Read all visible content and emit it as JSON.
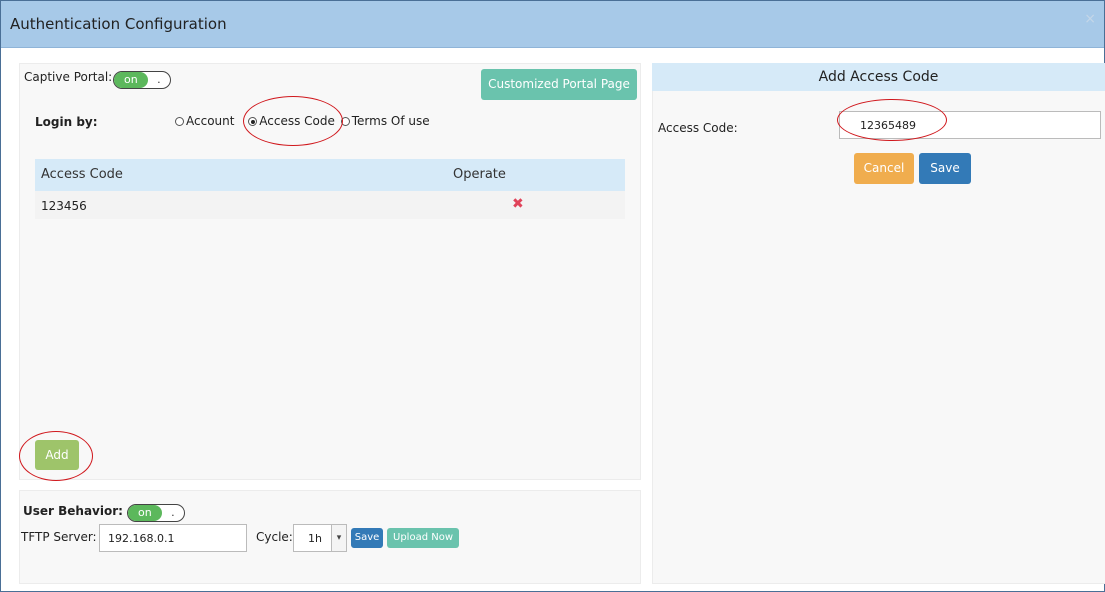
{
  "dialog": {
    "title": "Authentication Configuration",
    "close_glyph": "×"
  },
  "captive": {
    "label": "Captive Portal:",
    "toggle_on": "on",
    "toggle_knob": ".",
    "customized_button": "Customized Portal Page",
    "login_label": "Login by:",
    "options": [
      "Account",
      "Access Code",
      "Terms Of use"
    ],
    "selected_option": "Access Code",
    "table": {
      "headers": [
        "Access Code",
        "Operate"
      ],
      "rows": [
        {
          "code": "123456",
          "operate_glyph": "✖"
        }
      ]
    },
    "add_button": "Add"
  },
  "user_behavior": {
    "label": "User Behavior:",
    "toggle_on": "on",
    "toggle_knob": ".",
    "tftp_label": "TFTP Server:",
    "tftp_value": "192.168.0.1",
    "cycle_label": "Cycle:",
    "cycle_value": "1h",
    "save_button": "Save",
    "upload_button": "Upload Now"
  },
  "add_access_code": {
    "title": "Add Access Code",
    "field_label": "Access Code:",
    "field_value": "12365489",
    "cancel_button": "Cancel",
    "save_button": "Save"
  },
  "colors": {
    "title_bar": "#a7c9e8",
    "toggle_on": "#5cb85c",
    "teal_button": "#6ac3ad",
    "add_button": "#9ec46a",
    "cancel_button": "#f0ad4e",
    "save_button": "#337ab7",
    "delete_icon": "#e0435a",
    "annotation": "#d0181d"
  }
}
